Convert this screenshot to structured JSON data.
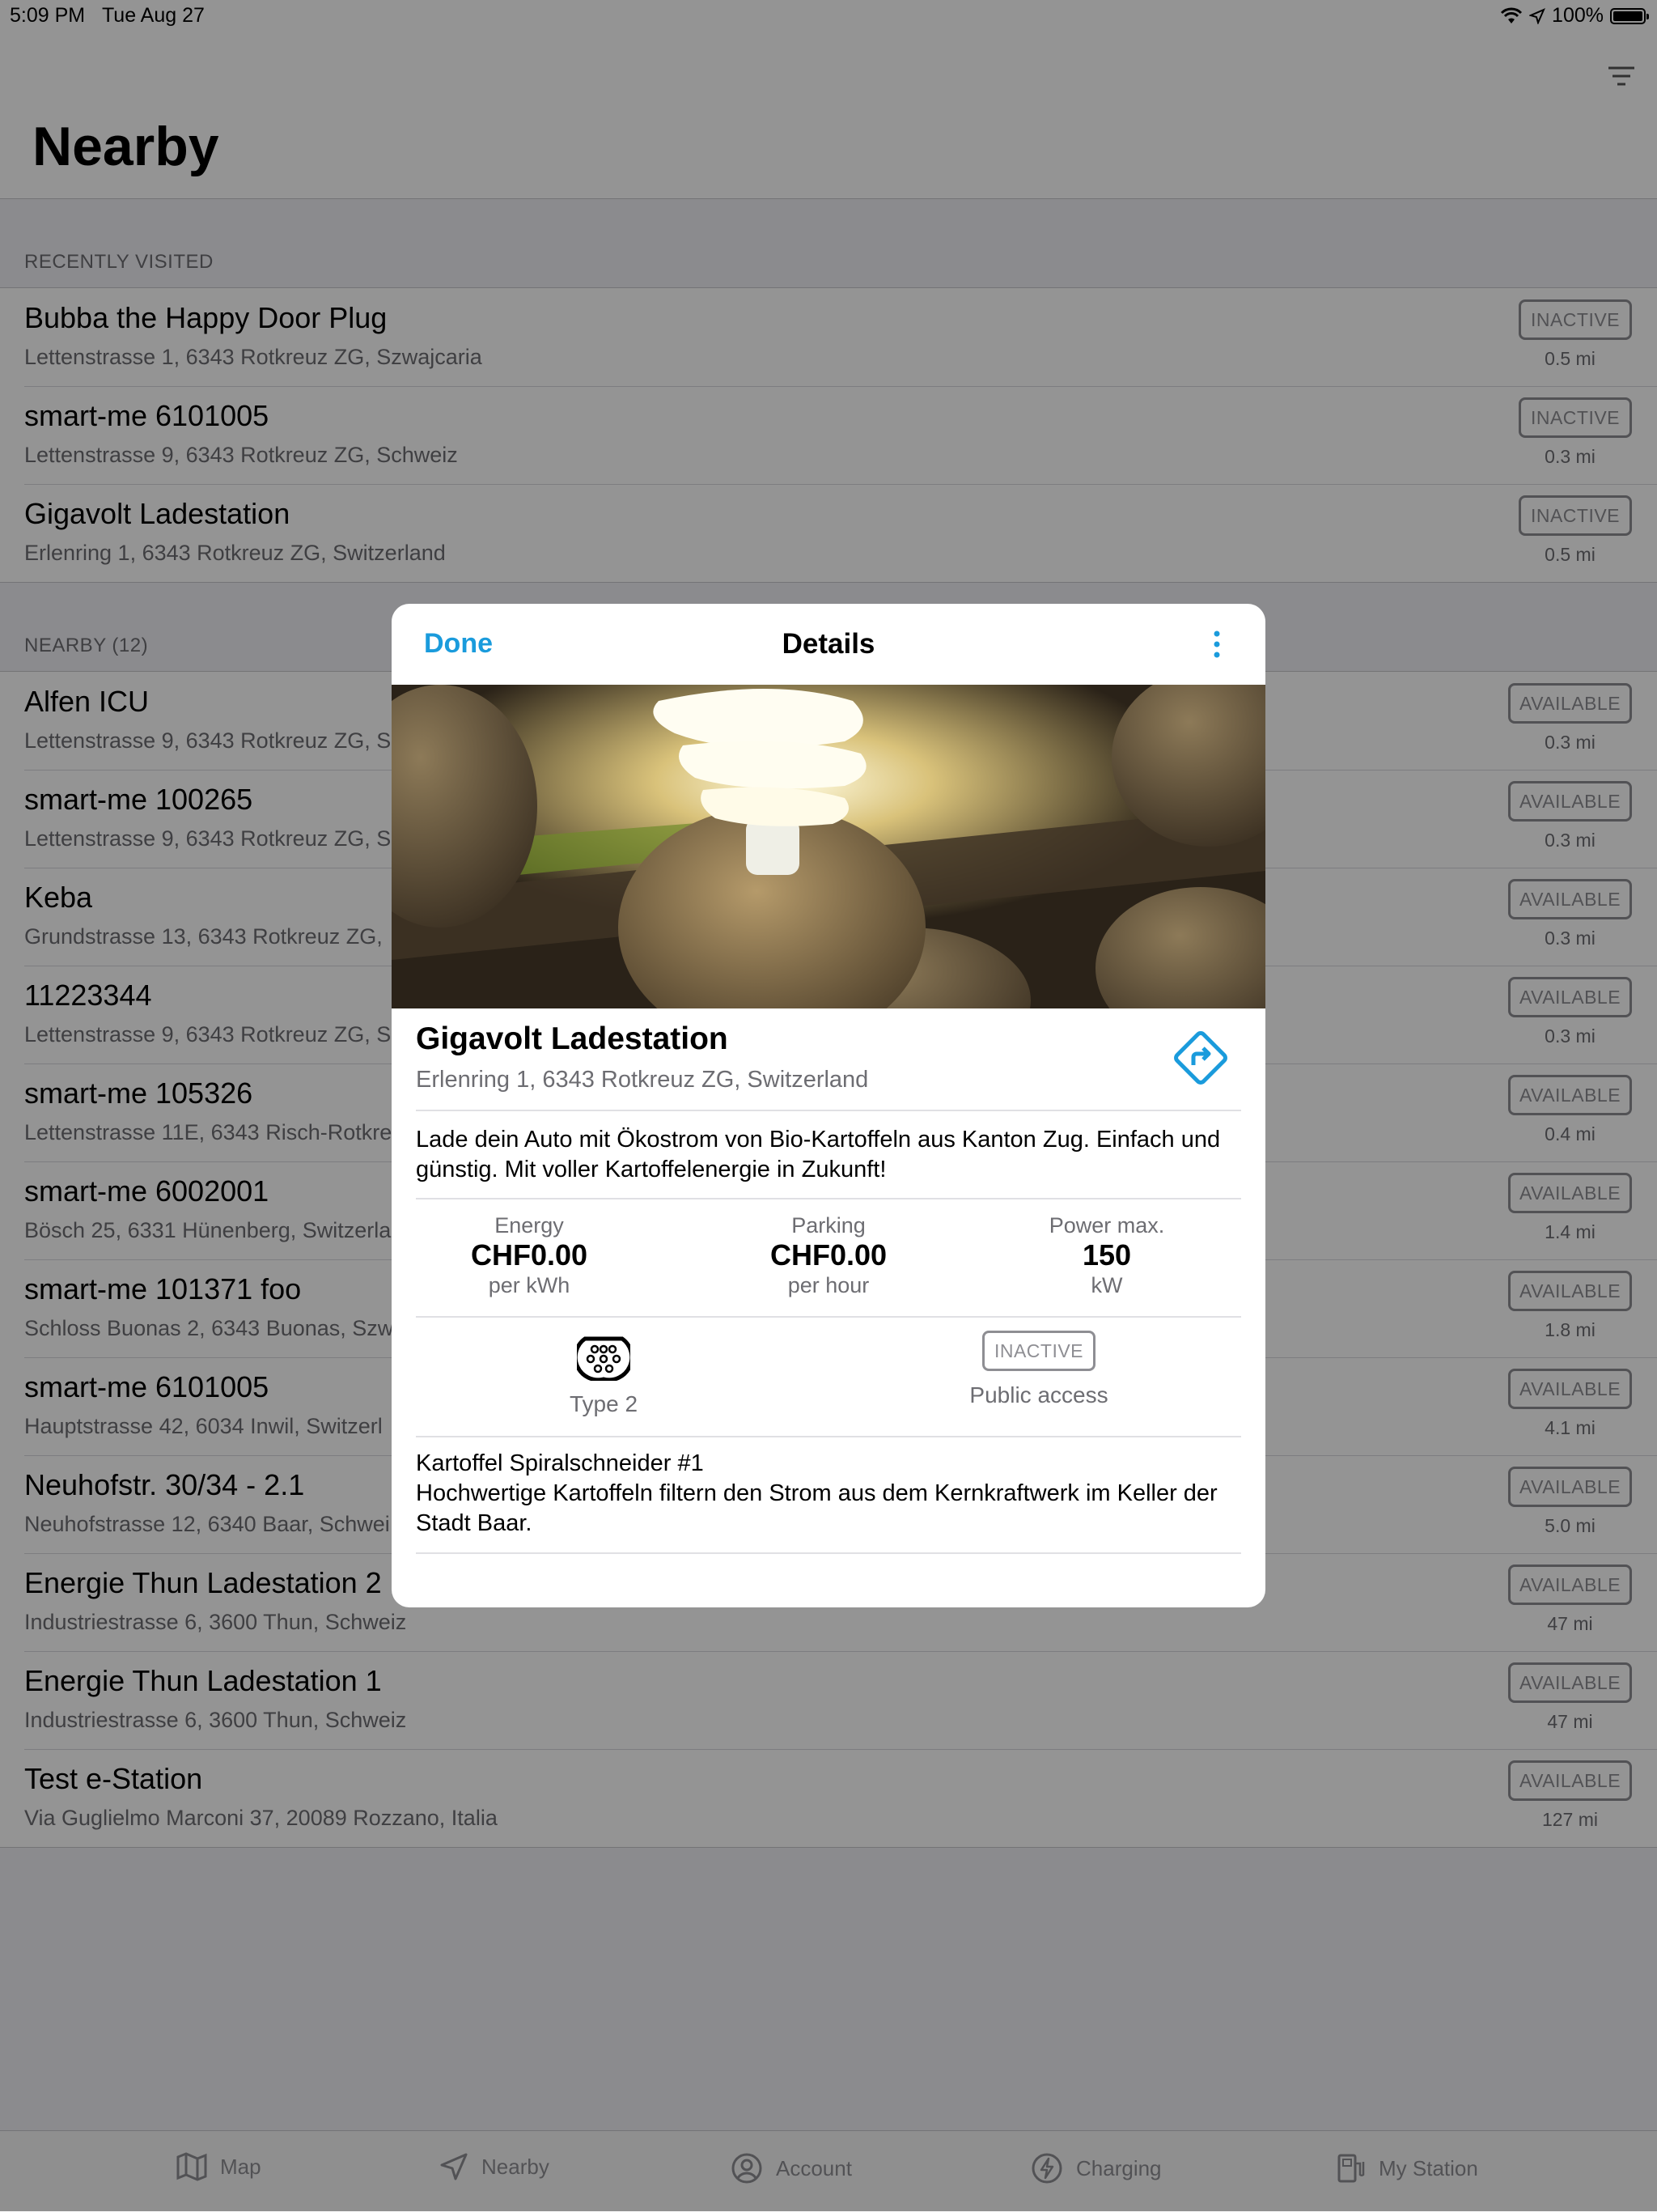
{
  "status_bar": {
    "time": "5:09 PM",
    "date": "Tue Aug 27",
    "battery": "100%"
  },
  "header": {
    "title": "Nearby",
    "filter_icon": "filter-icon"
  },
  "recent": {
    "header": "RECENTLY VISITED",
    "items": [
      {
        "title": "Bubba the Happy Door Plug",
        "address": "Lettenstrasse 1, 6343 Rotkreuz ZG, Szwajcaria",
        "status": "INACTIVE",
        "distance": "0.5 mi"
      },
      {
        "title": "smart-me 6101005",
        "address": "Lettenstrasse 9, 6343 Rotkreuz ZG, Schweiz",
        "status": "INACTIVE",
        "distance": "0.3 mi"
      },
      {
        "title": "Gigavolt Ladestation",
        "address": "Erlenring 1, 6343 Rotkreuz ZG, Switzerland",
        "status": "INACTIVE",
        "distance": "0.5 mi"
      }
    ]
  },
  "nearby": {
    "header": "NEARBY (12)",
    "items": [
      {
        "title": "Alfen ICU",
        "address": "Lettenstrasse 9, 6343 Rotkreuz ZG, Sc",
        "status": "AVAILABLE",
        "distance": "0.3 mi"
      },
      {
        "title": "smart-me 100265",
        "address": "Lettenstrasse 9, 6343 Rotkreuz ZG, Sc",
        "status": "AVAILABLE",
        "distance": "0.3 mi"
      },
      {
        "title": "Keba",
        "address": "Grundstrasse 13, 6343 Rotkreuz ZG,",
        "status": "AVAILABLE",
        "distance": "0.3 mi"
      },
      {
        "title": "11223344",
        "address": "Lettenstrasse 9, 6343 Rotkreuz ZG, Sc",
        "status": "AVAILABLE",
        "distance": "0.3 mi"
      },
      {
        "title": "smart-me 105326",
        "address": "Lettenstrasse 11E, 6343 Risch-Rotkre",
        "status": "AVAILABLE",
        "distance": "0.4 mi"
      },
      {
        "title": "smart-me 6002001",
        "address": "Bösch 25, 6331 Hünenberg, Switzerla",
        "status": "AVAILABLE",
        "distance": "1.4 mi"
      },
      {
        "title": "smart-me 101371 foo",
        "address": "Schloss Buonas 2, 6343 Buonas, Szwa",
        "status": "AVAILABLE",
        "distance": "1.8 mi"
      },
      {
        "title": "smart-me 6101005",
        "address": "Hauptstrasse 42, 6034 Inwil, Switzerl",
        "status": "AVAILABLE",
        "distance": "4.1 mi"
      },
      {
        "title": "Neuhofstr. 30/34 - 2.1",
        "address": "Neuhofstrasse 12, 6340 Baar, Schwei",
        "status": "AVAILABLE",
        "distance": "5.0 mi"
      },
      {
        "title": "Energie Thun Ladestation 2",
        "address": "Industriestrasse 6, 3600 Thun, Schweiz",
        "status": "AVAILABLE",
        "distance": "47 mi"
      },
      {
        "title": "Energie Thun Ladestation 1",
        "address": "Industriestrasse 6, 3600 Thun, Schweiz",
        "status": "AVAILABLE",
        "distance": "47 mi"
      },
      {
        "title": "Test e-Station",
        "address": "Via Guglielmo Marconi 37, 20089 Rozzano, Italia",
        "status": "AVAILABLE",
        "distance": "127 mi"
      }
    ]
  },
  "tabs": [
    {
      "label": "Map",
      "icon": "map-icon"
    },
    {
      "label": "Nearby",
      "icon": "location-arrow-icon"
    },
    {
      "label": "Account",
      "icon": "account-icon"
    },
    {
      "label": "Charging",
      "icon": "bolt-icon"
    },
    {
      "label": "My Station",
      "icon": "charging-station-icon"
    }
  ],
  "modal": {
    "done": "Done",
    "title": "Details",
    "name": "Gigavolt Ladestation",
    "address": "Erlenring 1, 6343 Rotkreuz ZG, Switzerland",
    "description": "Lade dein Auto mit Ökostrom von Bio-Kartoffeln aus Kanton Zug. Einfach und günstig. Mit voller Kartoffelenergie in Zukunft!",
    "stats": [
      {
        "label": "Energy",
        "value": "CHF0.00",
        "unit": "per kWh"
      },
      {
        "label": "Parking",
        "value": "CHF0.00",
        "unit": "per hour"
      },
      {
        "label": "Power max.",
        "value": "150",
        "unit": "kW"
      }
    ],
    "connector": "Type 2",
    "status": "INACTIVE",
    "access": "Public access",
    "notes_title": "Kartoffel Spiralschneider #1",
    "notes": "Hochwertige Kartoffeln filtern den Strom aus dem Kernkraftwerk im Keller der Stadt Baar."
  },
  "colors": {
    "accent": "#1a9bdc",
    "badge": "#8e8e93"
  }
}
